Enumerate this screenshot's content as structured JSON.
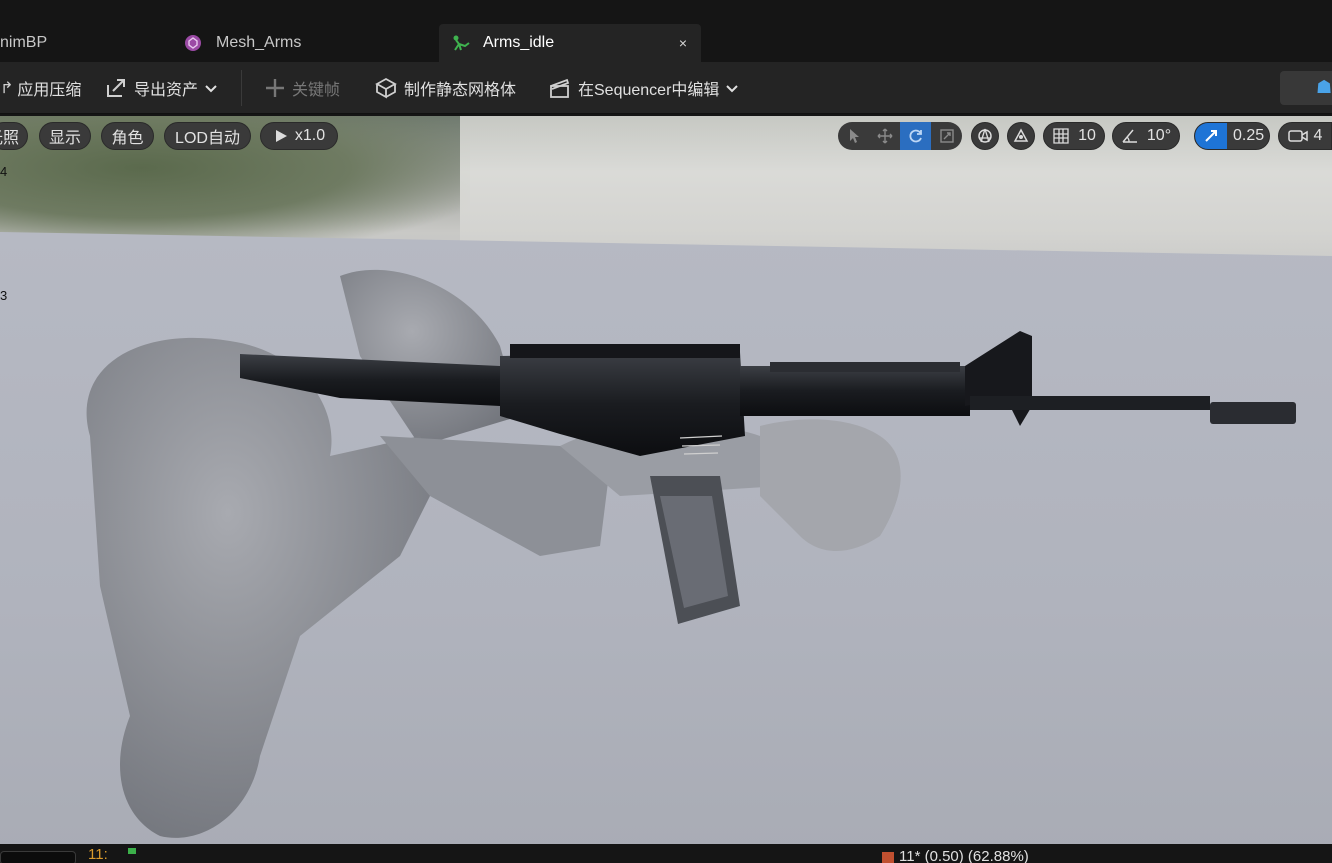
{
  "tabs": [
    {
      "label": "nimBP",
      "active": false
    },
    {
      "label": "Mesh_Arms",
      "active": false
    },
    {
      "label": "Arms_idle",
      "active": true,
      "close": "×"
    }
  ],
  "toolbar": {
    "apply_compression": "应用压缩",
    "export_asset": "导出资产",
    "keyframe": "关键帧",
    "make_static_mesh": "制作静态网格体",
    "edit_in_sequencer": "在Sequencer中编辑"
  },
  "viewport": {
    "lighting_label": "光照",
    "show_label": "显示",
    "character_label": "角色",
    "lod_label": "LOD自动",
    "play_speed": "x1.0",
    "grid_snap": "10",
    "rotation_snap": "10°",
    "scale_snap": "0.25",
    "camera_speed": "4",
    "side_labels": [
      "4",
      "3"
    ],
    "magazine_text": "RESTRICTED MIL./GOVT. USE ONLY"
  },
  "statusbar": {
    "marker": "11:",
    "frame_readout": "11* (0.50) (62.88%)"
  },
  "colors": {
    "accent": "#1e74d6",
    "tab_active": "#242424",
    "background": "#151515"
  }
}
